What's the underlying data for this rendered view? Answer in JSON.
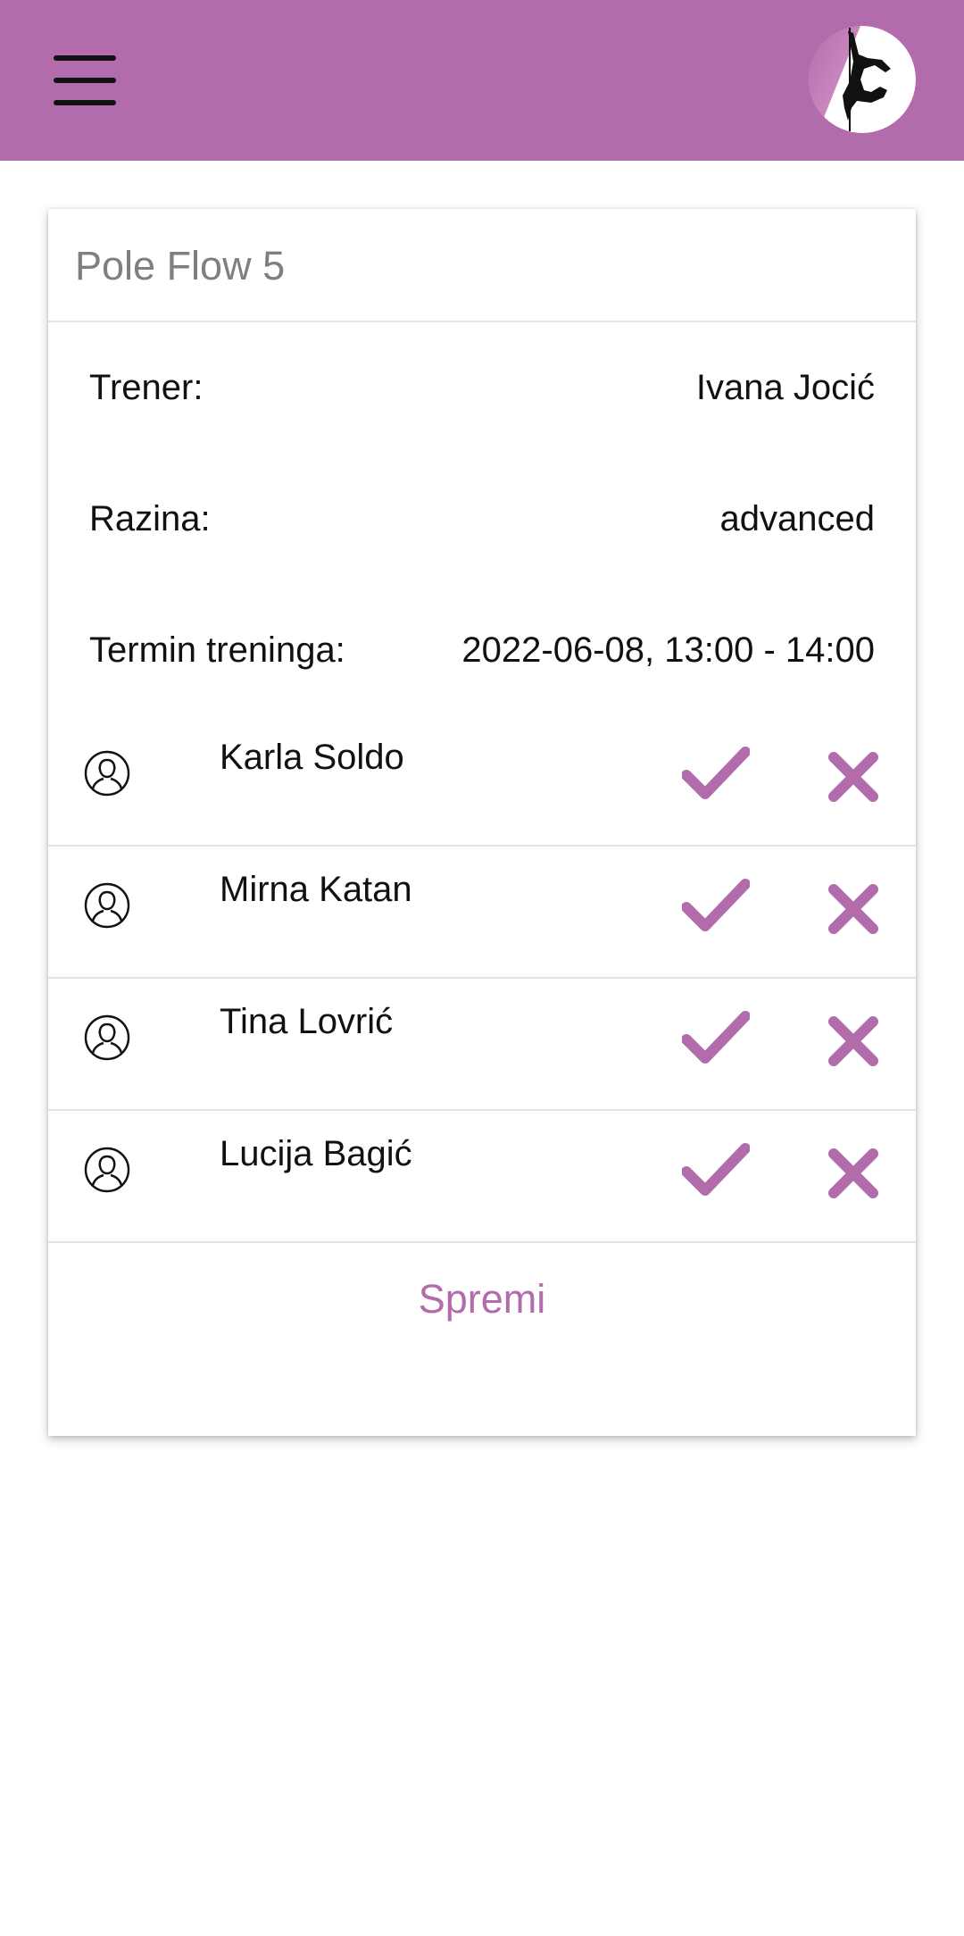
{
  "header": {
    "menu_icon": "hamburger-menu-icon",
    "logo": "pole-dancer-logo",
    "background_color": "#b36cab"
  },
  "card": {
    "title": "Pole Flow 5",
    "trainer_label": "Trener:",
    "trainer_value": "Ivana Jocić",
    "level_label": "Razina:",
    "level_value": "advanced",
    "schedule_label": "Termin treninga:",
    "schedule_value": "2022-06-08, 13:00 - 14:00"
  },
  "participants": [
    {
      "name": "Karla Soldo"
    },
    {
      "name": "Mirna Katan"
    },
    {
      "name": "Tina Lovrić"
    },
    {
      "name": "Lucija Bagić"
    }
  ],
  "icons": {
    "user": "user-outline-icon",
    "accept": "checkmark-icon",
    "reject": "close-icon"
  },
  "colors": {
    "accent": "#b36cab",
    "divider": "#e3e3e3"
  },
  "actions": {
    "save_label": "Spremi"
  }
}
